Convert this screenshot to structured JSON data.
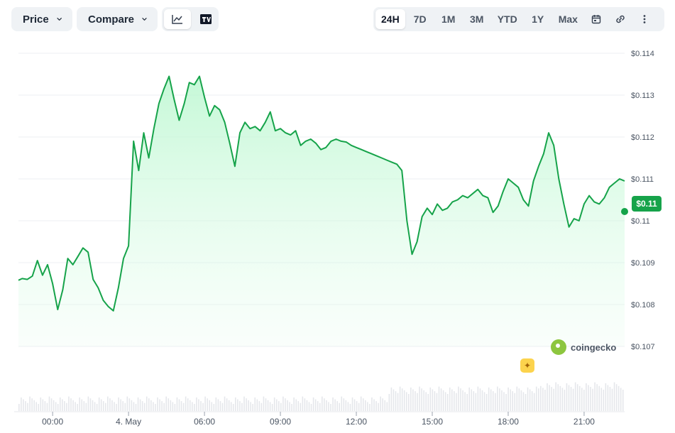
{
  "toolbar": {
    "price_label": "Price",
    "compare_label": "Compare",
    "chart_type_icons": [
      "line-chart-icon",
      "tradingview-icon"
    ],
    "ranges": [
      "24H",
      "7D",
      "1M",
      "3M",
      "YTD",
      "1Y",
      "Max"
    ],
    "active_range": "24H",
    "right_icons": [
      "calendar-icon",
      "link-icon",
      "more-vertical-icon"
    ]
  },
  "current_price_label": "$0.11",
  "watermark": "coingecko",
  "colors": {
    "line": "#16a34a",
    "badge": "#16a34a",
    "fill_top": "#bbf7d0"
  },
  "chart_data": {
    "type": "area",
    "x_ticks": [
      "00:00",
      "4. May",
      "06:00",
      "09:00",
      "12:00",
      "15:00",
      "18:00",
      "21:00"
    ],
    "x_tick_hours": [
      0,
      3,
      6,
      9,
      12,
      15,
      18,
      21
    ],
    "x_range": [
      -1.35,
      22.6
    ],
    "y_ticks": [
      "$0.107",
      "$0.108",
      "$0.109",
      "$0.11",
      "$0.111",
      "$0.112",
      "$0.113",
      "$0.114"
    ],
    "y_tick_values": [
      0.107,
      0.108,
      0.109,
      0.11,
      0.111,
      0.112,
      0.113,
      0.114
    ],
    "ylim": [
      0.107,
      0.114
    ],
    "grid": true,
    "x": [
      -1.35,
      -1.2,
      -1.0,
      -0.8,
      -0.6,
      -0.4,
      -0.2,
      0.0,
      0.2,
      0.4,
      0.6,
      0.8,
      1.0,
      1.2,
      1.4,
      1.6,
      1.8,
      2.0,
      2.2,
      2.4,
      2.6,
      2.8,
      3.0,
      3.2,
      3.4,
      3.6,
      3.8,
      4.0,
      4.2,
      4.4,
      4.6,
      4.8,
      5.0,
      5.2,
      5.4,
      5.6,
      5.8,
      6.0,
      6.2,
      6.4,
      6.6,
      6.8,
      7.0,
      7.2,
      7.4,
      7.6,
      7.8,
      8.0,
      8.2,
      8.4,
      8.6,
      8.8,
      9.0,
      9.2,
      9.4,
      9.6,
      9.8,
      10.0,
      10.2,
      10.4,
      10.6,
      10.8,
      11.0,
      11.2,
      11.4,
      11.6,
      11.8,
      12.0,
      12.2,
      12.4,
      12.6,
      12.8,
      13.0,
      13.2,
      13.4,
      13.6,
      13.8,
      14.0,
      14.2,
      14.4,
      14.6,
      14.8,
      15.0,
      15.2,
      15.4,
      15.6,
      15.8,
      16.0,
      16.2,
      16.4,
      16.6,
      16.8,
      17.0,
      17.2,
      17.4,
      17.6,
      17.8,
      18.0,
      18.2,
      18.4,
      18.6,
      18.8,
      19.0,
      19.2,
      19.4,
      19.6,
      19.8,
      20.0,
      20.2,
      20.4,
      20.6,
      20.8,
      21.0,
      21.2,
      21.4,
      21.6,
      21.8,
      22.0,
      22.2,
      22.4,
      22.6
    ],
    "series": [
      {
        "values": [
          0.10858,
          0.10862,
          0.1086,
          0.10868,
          0.10905,
          0.1087,
          0.10895,
          0.1085,
          0.10788,
          0.10835,
          0.1091,
          0.10895,
          0.10915,
          0.10935,
          0.10925,
          0.1086,
          0.1084,
          0.1081,
          0.10795,
          0.10785,
          0.1084,
          0.1091,
          0.1094,
          0.1119,
          0.1112,
          0.1121,
          0.1115,
          0.1122,
          0.1128,
          0.11315,
          0.11345,
          0.1129,
          0.1124,
          0.1128,
          0.1133,
          0.11325,
          0.11345,
          0.11295,
          0.1125,
          0.11275,
          0.11265,
          0.11235,
          0.11185,
          0.1113,
          0.1121,
          0.11235,
          0.1122,
          0.11225,
          0.11215,
          0.11235,
          0.1126,
          0.11215,
          0.1122,
          0.1121,
          0.11205,
          0.11215,
          0.1118,
          0.1119,
          0.11195,
          0.11185,
          0.1117,
          0.11175,
          0.1119,
          0.11195,
          0.1119,
          0.11188,
          0.1118,
          0.11175,
          0.1117,
          0.11165,
          0.1116,
          0.11155,
          0.1115,
          0.11145,
          0.1114,
          0.11135,
          0.1112,
          0.11,
          0.1092,
          0.1095,
          0.1101,
          0.1103,
          0.11015,
          0.1104,
          0.11025,
          0.1103,
          0.11045,
          0.1105,
          0.1106,
          0.11055,
          0.11065,
          0.11075,
          0.1106,
          0.11055,
          0.1102,
          0.11035,
          0.1107,
          0.111,
          0.1109,
          0.1108,
          0.1105,
          0.11035,
          0.11095,
          0.1113,
          0.1116,
          0.1121,
          0.1118,
          0.111,
          0.1104,
          0.10985,
          0.11005,
          0.11,
          0.1104,
          0.1106,
          0.11045,
          0.1104,
          0.11055,
          0.1108,
          0.1109,
          0.111,
          0.11095,
          0.11115,
          0.1111,
          0.11105,
          0.11085,
          0.11065,
          0.11045,
          0.1104,
          0.1103,
          0.11022
        ]
      }
    ],
    "volume_note": "volume bars shown along bottom"
  }
}
